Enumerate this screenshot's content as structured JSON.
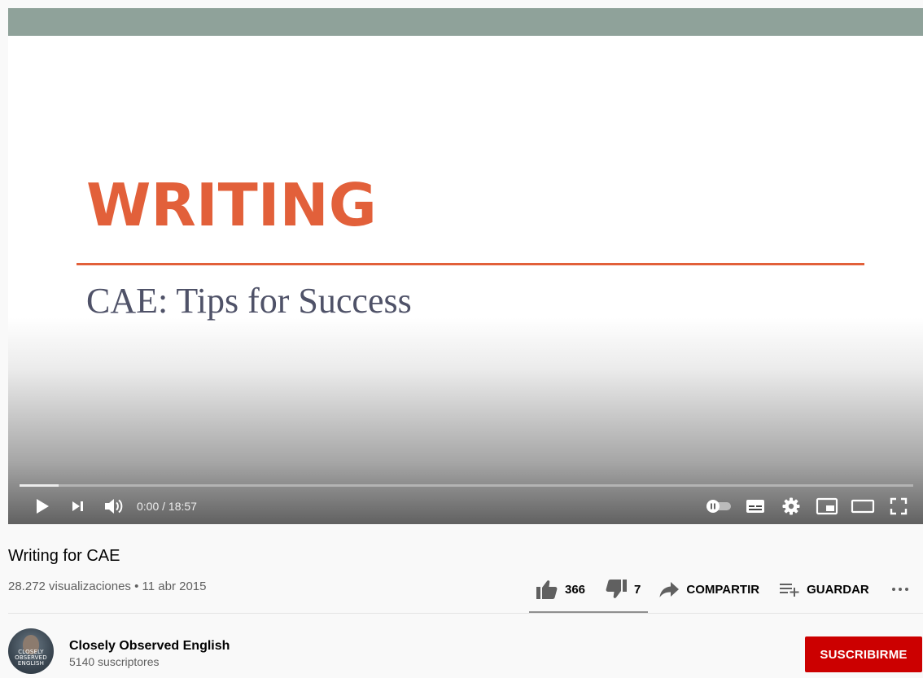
{
  "player": {
    "slide_title": "WRITING",
    "slide_subtitle": "CAE: Tips for Success",
    "current_time": "0:00",
    "time_separator": " / ",
    "duration": "18:57",
    "buffered_fraction": 0.044,
    "autoplay_enabled": false
  },
  "video": {
    "title": "Writing for CAE",
    "views": "28.272 visualizaciones",
    "meta_separator": " • ",
    "date": "11 abr 2015"
  },
  "actions": {
    "likes": "366",
    "dislikes": "7",
    "share_label": "COMPARTIR",
    "save_label": "GUARDAR",
    "like_fraction": 0.98
  },
  "channel": {
    "name": "Closely Observed English",
    "subscribers": "5140 suscriptores",
    "avatar_text": [
      "CLOSELY",
      "OBSERVED",
      "ENGLISH"
    ],
    "subscribe_label": "SUSCRIBIRME"
  },
  "colors": {
    "slide_accent": "#e2603a",
    "slide_band": "#8fa29a",
    "subscribe_red": "#cc0000"
  },
  "icons": {
    "controls_left": [
      "play-icon",
      "next-icon",
      "volume-icon"
    ],
    "controls_right": [
      "autoplay-toggle-icon",
      "subtitles-icon",
      "settings-gear-icon",
      "miniplayer-icon",
      "theater-mode-icon",
      "fullscreen-icon"
    ],
    "actions": [
      "thumbs-up-icon",
      "thumbs-down-icon",
      "share-arrow-icon",
      "playlist-add-icon",
      "more-icon"
    ]
  }
}
